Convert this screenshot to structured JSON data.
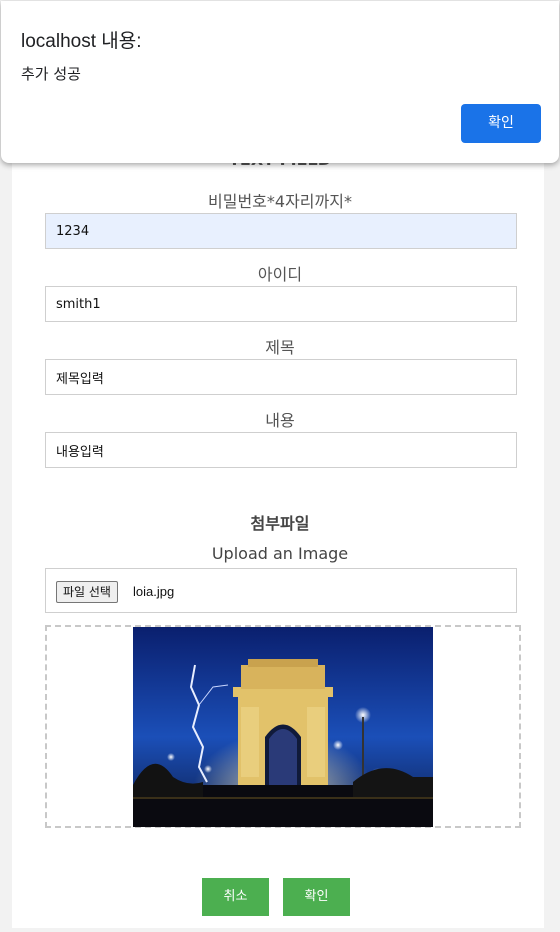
{
  "form": {
    "section_title": "TEXT FIELD",
    "fields": [
      {
        "label": "비밀번호*4자리까지*",
        "value": "1234"
      },
      {
        "label": "아이디",
        "value": "smith1"
      },
      {
        "label": "제목",
        "value": "제목입력"
      },
      {
        "label": "내용",
        "value": "내용입력"
      }
    ],
    "attachment": {
      "title": "첨부파일",
      "upload_label": "Upload an Image",
      "file_button": "파일 선택",
      "file_name": "loia.jpg"
    },
    "buttons": {
      "cancel": "취소",
      "confirm": "확인"
    }
  },
  "dialog": {
    "title": "localhost 내용:",
    "message": "추가 성공",
    "ok_label": "확인",
    "ok_color": "#1a73e8"
  },
  "colors": {
    "button_green": "#4caf50",
    "autofill_bg": "#e8f0fe"
  }
}
